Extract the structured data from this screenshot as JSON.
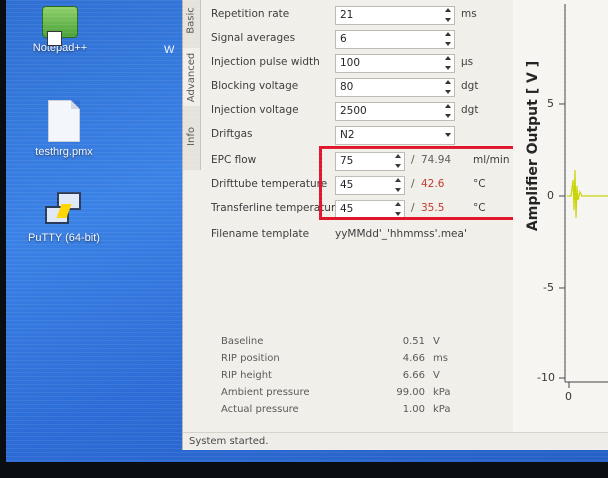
{
  "desktop": {
    "icons": [
      {
        "label": "Notepad++"
      },
      {
        "label": "testhrg.pmx"
      },
      {
        "label": "PuTTY (64-bit)"
      }
    ],
    "clipped_label": "W"
  },
  "app": {
    "tabs": [
      "Basic",
      "Advanced",
      "Info"
    ],
    "settings": {
      "repetition_rate": {
        "label": "Repetition rate",
        "value": "21",
        "unit": "ms"
      },
      "signal_averages": {
        "label": "Signal averages",
        "value": "6",
        "unit": ""
      },
      "injection_pulse_width": {
        "label": "Injection pulse width",
        "value": "100",
        "unit": "µs"
      },
      "blocking_voltage": {
        "label": "Blocking voltage",
        "value": "80",
        "unit": "dgt"
      },
      "injection_voltage": {
        "label": "Injection voltage",
        "value": "2500",
        "unit": "dgt"
      },
      "driftgas": {
        "label": "Driftgas",
        "value": "N2"
      },
      "epc_flow": {
        "label": "EPC flow",
        "value": "75",
        "sep": "/",
        "actual": "74.94",
        "unit": "ml/min"
      },
      "drifttube_temperature": {
        "label": "Drifttube temperature",
        "value": "45",
        "sep": "/",
        "actual": "42.6",
        "unit": "°C"
      },
      "transferline_temperature": {
        "label": "Transferline temperature",
        "value": "45",
        "sep": "/",
        "actual": "35.5",
        "unit": "°C"
      },
      "filename_template": {
        "label": "Filename template",
        "value": "yyMMdd'_'hhmmss'.mea'"
      }
    },
    "status": [
      {
        "key": "Baseline",
        "value": "0.51",
        "unit": "V"
      },
      {
        "key": "RIP position",
        "value": "4.66",
        "unit": "ms"
      },
      {
        "key": "RIP height",
        "value": "6.66",
        "unit": "V"
      },
      {
        "key": "Ambient pressure",
        "value": "99.00",
        "unit": "kPa"
      },
      {
        "key": "Actual pressure",
        "value": "1.00",
        "unit": "kPa"
      }
    ],
    "status_bar": "System started.",
    "plot": {
      "ylabel": "Amplifier Output [ V ]",
      "yticks": [
        "5",
        "0",
        "-5",
        "-10"
      ],
      "xticks": [
        "0"
      ]
    },
    "colors": {
      "highlight": "#e0162b",
      "actual_warning": "#c0392b",
      "signal": "#c8d400"
    }
  }
}
